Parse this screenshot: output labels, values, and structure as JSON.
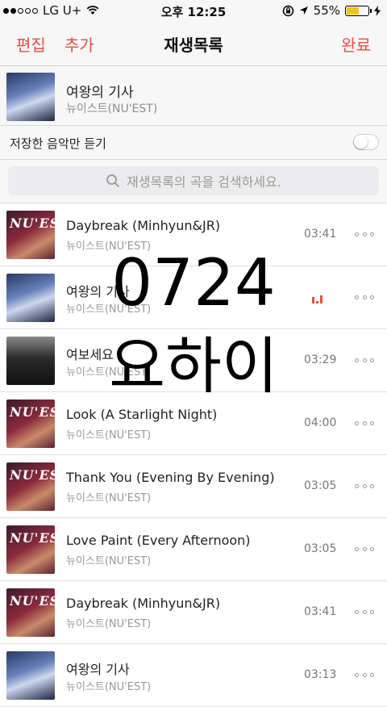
{
  "status": {
    "carrier": "LG U+",
    "time": "오후 12:25",
    "battery": "55%",
    "battery_level": 0.55,
    "signal_dots": 5,
    "signal_filled": 2
  },
  "nav": {
    "edit_label": "편집",
    "add_label": "추가",
    "title": "재생목록",
    "done_label": "완료"
  },
  "playlist_header": {
    "title": "여왕의 기사",
    "artist": "뉴이스트(NU'EST)"
  },
  "toggle": {
    "label": "저장한 음악만 듣기",
    "on": false
  },
  "search": {
    "placeholder": "재생목록의 곡을 검색하세요."
  },
  "songs": [
    {
      "title": "Daybreak (Minhyun&JR)",
      "artist": "뉴이스트(NU'EST)",
      "duration": "03:41",
      "cover": "nuest",
      "cover_text": "NU'EST",
      "playing": false
    },
    {
      "title": "여왕의 기사",
      "artist": "뉴이스트(NU'EST)",
      "duration": "",
      "cover": "knight",
      "cover_text": "",
      "playing": true
    },
    {
      "title": "여보세요",
      "artist": "뉴이스트(NU'EST)",
      "duration": "03:29",
      "cover": "hello",
      "cover_text": "",
      "playing": false
    },
    {
      "title": "Look (A Starlight Night)",
      "artist": "뉴이스트(NU'EST)",
      "duration": "04:00",
      "cover": "nuest",
      "cover_text": "NU'EST",
      "playing": false
    },
    {
      "title": "Thank You (Evening By Evening)",
      "artist": "뉴이스트(NU'EST)",
      "duration": "03:05",
      "cover": "nuest",
      "cover_text": "NU'EST",
      "playing": false
    },
    {
      "title": "Love Paint (Every Afternoon)",
      "artist": "뉴이스트(NU'EST)",
      "duration": "03:05",
      "cover": "nuest",
      "cover_text": "NU'EST",
      "playing": false
    },
    {
      "title": "Daybreak (Minhyun&JR)",
      "artist": "뉴이스트(NU'EST)",
      "duration": "03:41",
      "cover": "nuest",
      "cover_text": "NU'EST",
      "playing": false
    },
    {
      "title": "여왕의 기사",
      "artist": "뉴이스트(NU'EST)",
      "duration": "03:13",
      "cover": "knight",
      "cover_text": "",
      "playing": false
    }
  ],
  "overlay": {
    "line1": "0724",
    "line2": "요하이"
  },
  "colors": {
    "accent": "#e8503f",
    "battery": "#f1c40f"
  }
}
